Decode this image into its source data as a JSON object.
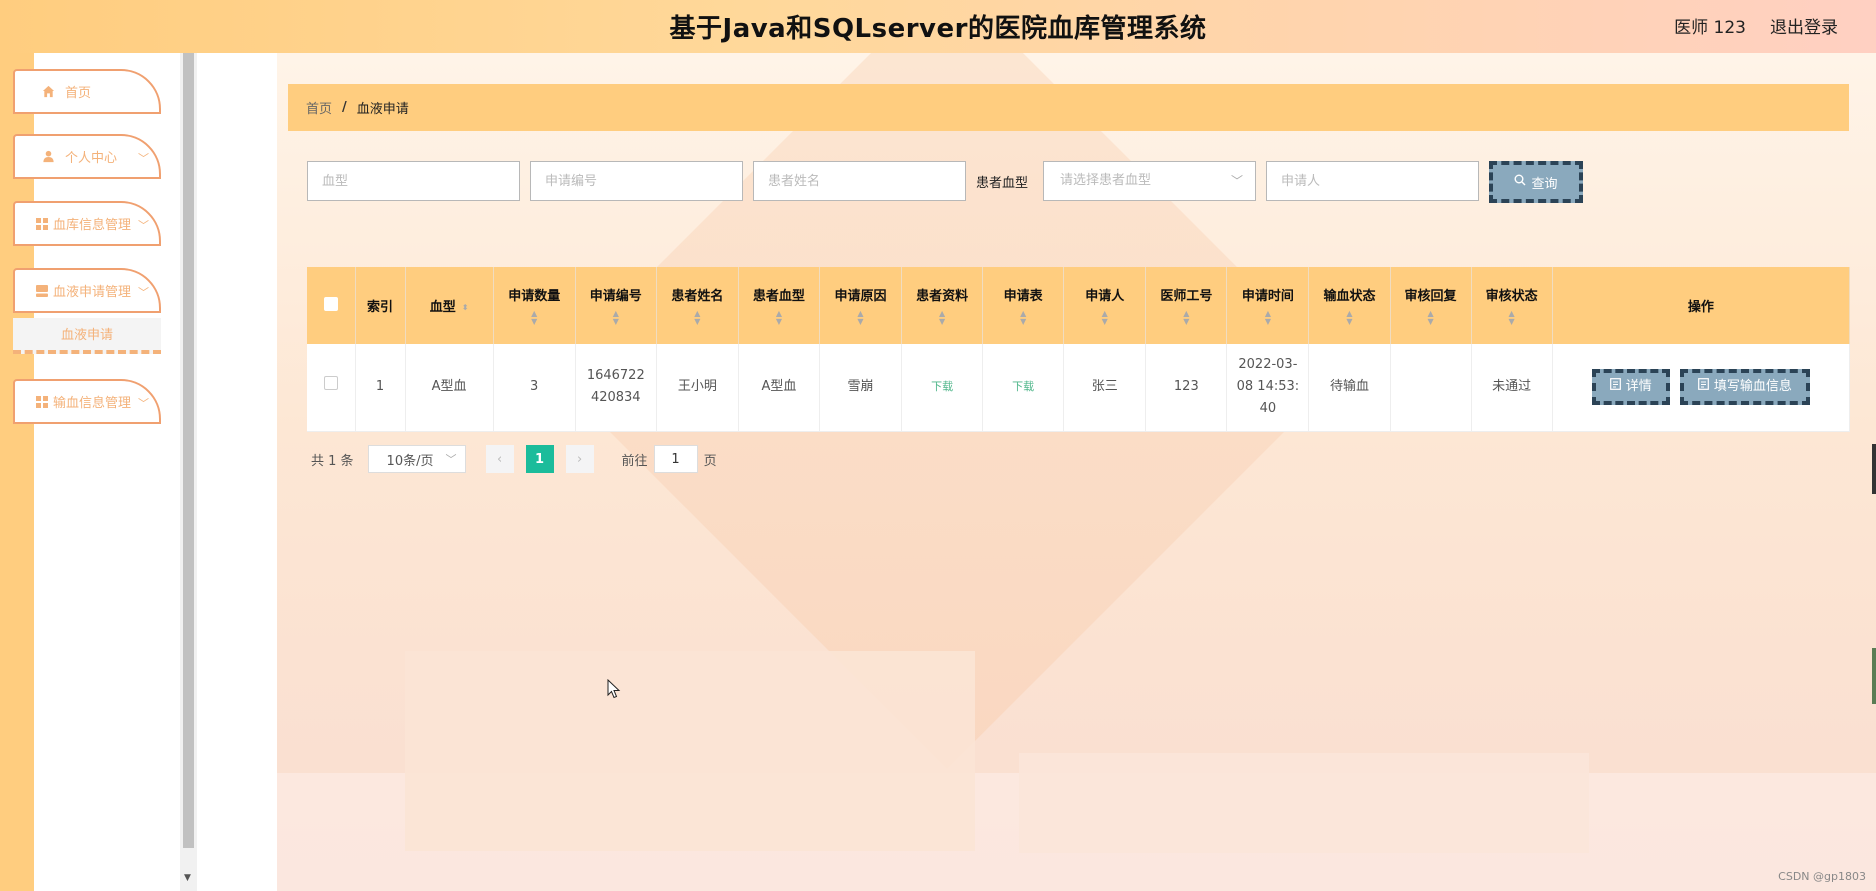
{
  "header": {
    "title": "基于Java和SQLserver的医院血库管理系统",
    "user": "医师 123",
    "logout": "退出登录"
  },
  "sidebar": {
    "items": [
      {
        "label": "首页",
        "icon": "home-icon"
      },
      {
        "label": "个人中心",
        "icon": "user-icon"
      },
      {
        "label": "血库信息管理",
        "icon": "grid-icon"
      },
      {
        "label": "血液申请管理",
        "icon": "grid-icon"
      },
      {
        "label": "输血信息管理",
        "icon": "grid-icon"
      }
    ],
    "submenu": "血液申请"
  },
  "breadcrumb": {
    "home": "首页",
    "separator": "/",
    "current": "血液申请"
  },
  "search": {
    "blood_type_placeholder": "血型",
    "apply_no_placeholder": "申请编号",
    "patient_name_placeholder": "患者姓名",
    "patient_blood_label": "患者血型",
    "patient_blood_select": "请选择患者血型",
    "applicant_placeholder": "申请人",
    "query_button": "查询"
  },
  "table": {
    "columns": [
      "索引",
      "血型",
      "申请数量",
      "申请编号",
      "患者姓名",
      "患者血型",
      "申请原因",
      "患者资料",
      "申请表",
      "申请人",
      "医师工号",
      "申请时间",
      "输血状态",
      "审核回复",
      "审核状态",
      "操作"
    ],
    "rows": [
      {
        "index": "1",
        "blood_type": "A型血",
        "quantity": "3",
        "apply_no_line1": "1646722",
        "apply_no_line2": "420834",
        "patient_name": "王小明",
        "patient_blood": "A型血",
        "reason": "雪崩",
        "patient_file": "下载",
        "apply_form": "下载",
        "applicant": "张三",
        "doctor_id": "123",
        "apply_time_line1": "2022-03-",
        "apply_time_line2": "08 14:53:",
        "apply_time_line3": "40",
        "transfusion_status": "待输血",
        "review_reply": "",
        "review_status": "未通过",
        "detail_button": "详情",
        "fill_button": "填写输血信息"
      }
    ]
  },
  "pagination": {
    "total": "共 1 条",
    "page_size": "10条/页",
    "current_page": "1",
    "goto_label": "前往",
    "goto_value": "1",
    "page_suffix": "页"
  },
  "watermark": "CSDN @gp1803",
  "colors": {
    "accent": "#ffcd7f",
    "button": "#8aa9bd",
    "button_border": "#2b4356",
    "pager_active": "#1bbc9b",
    "link": "#4fb68a"
  }
}
